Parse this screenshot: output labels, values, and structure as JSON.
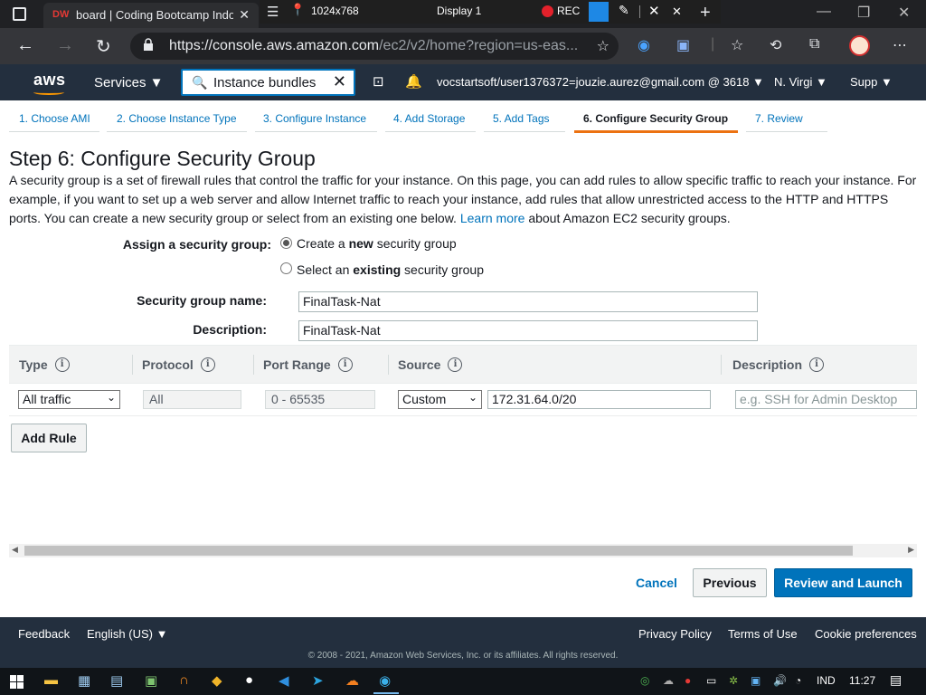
{
  "browser": {
    "tab_favicon": "DW",
    "tab_title": "board | Coding Bootcamp Indonesia",
    "recorder": {
      "resolution": "1024x768",
      "display": "Display 1",
      "rec_label": "REC"
    },
    "url_host": "https://console.aws.amazon.com",
    "url_path": "/ec2/v2/home?region=us-eas..."
  },
  "aws_header": {
    "logo": "aws",
    "services_label": "Services ▼",
    "search_value": "Instance bundles",
    "account": "vocstartsoft/user1376372=jouzie.aurez@gmail.com @ 3618 ▼",
    "region": "N. Virgi ▼",
    "support": "Supp ▼"
  },
  "wizard_steps": [
    {
      "label": "1. Choose AMI"
    },
    {
      "label": "2. Choose Instance Type"
    },
    {
      "label": "3. Configure Instance"
    },
    {
      "label": "4. Add Storage"
    },
    {
      "label": "5. Add Tags"
    },
    {
      "label": "6. Configure Security Group"
    },
    {
      "label": "7. Review"
    }
  ],
  "page": {
    "title": "Step 6: Configure Security Group",
    "intro_text": "A security group is a set of firewall rules that control the traffic for your instance. On this page, you can add rules to allow specific traffic to reach your instance. For example, if you want to set up a web server and allow Internet traffic to reach your instance, add rules that allow unrestricted access to the HTTP and HTTPS ports. You can create a new security group or select from an existing one below.",
    "learn_more": "Learn more",
    "intro_tail": "about Amazon EC2 security groups.",
    "assign_label": "Assign a security group:",
    "option_create_pre": "Create a ",
    "option_create_bold": "new",
    "option_create_post": " security group",
    "option_select_pre": "Select an ",
    "option_select_bold": "existing",
    "option_select_post": " security group",
    "sg_name_label": "Security group name:",
    "sg_name_value": "FinalTask-Nat",
    "description_label": "Description:",
    "description_value": "FinalTask-Nat"
  },
  "rules_table": {
    "headers": [
      "Type",
      "Protocol",
      "Port Range",
      "Source",
      "Description"
    ],
    "rows": [
      {
        "type": "All traffic",
        "protocol": "All",
        "port_range": "0 - 65535",
        "source_type": "Custom",
        "source_value": "172.31.64.0/20",
        "description_placeholder": "e.g. SSH for Admin Desktop"
      }
    ],
    "add_rule_label": "Add Rule"
  },
  "actions": {
    "cancel": "Cancel",
    "previous": "Previous",
    "review_launch": "Review and Launch"
  },
  "aws_footer": {
    "feedback": "Feedback",
    "language": "English (US) ▼",
    "privacy": "Privacy Policy",
    "terms": "Terms of Use",
    "cookies": "Cookie preferences",
    "copyright": "© 2008 - 2021, Amazon Web Services, Inc. or its affiliates. All rights reserved."
  },
  "taskbar": {
    "language": "IND",
    "time": "11:27"
  },
  "colors": {
    "aws_nav": "#232f3e",
    "link": "#0073bb",
    "active_step": "#ec7211",
    "primary_button": "#0073bb"
  }
}
